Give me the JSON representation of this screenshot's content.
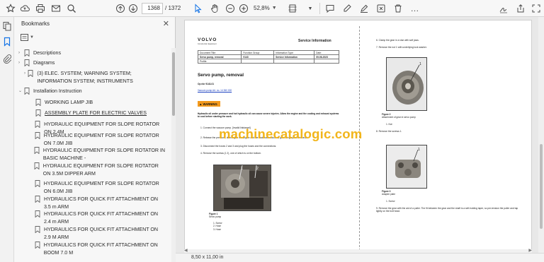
{
  "toolbar": {
    "current_page": "1368",
    "total_pages": "/ 1372",
    "zoom": "52,8%"
  },
  "panel": {
    "title": "Bookmarks",
    "close": "✕"
  },
  "bookmarks": [
    {
      "label": "Descriptions",
      "expand": "›",
      "underline": false
    },
    {
      "label": "Diagrams",
      "expand": "›",
      "underline": false
    },
    {
      "label": "(3) ELEC. SYSTEM; WARNING SYSTEM; INFORMATION SYSTEM; INSTRUMENTS",
      "expand": "›",
      "underline": false
    },
    {
      "label": "Installation Instruction",
      "expand": "⌄",
      "underline": false
    },
    {
      "label": "WORKING LAMP JIB",
      "expand": "",
      "underline": false
    },
    {
      "label": "ASSEMBLY PLATE FOR ELECTRIC VALVES",
      "expand": "",
      "underline": true
    },
    {
      "label": "HYDRAULIC EQUIPMENT FOR SLOPE ROTATOR ON 2.4M",
      "expand": "",
      "underline": false
    },
    {
      "label": "HYDRAULIC EQUIPMENT FOR SLOPE ROTATOR ON 7.0M JIB",
      "expand": "",
      "underline": false
    },
    {
      "label": "HYDRAULIC EQUIPMENT FOR SLOPE ROTATOR IN BASIC MACHINE -",
      "expand": "",
      "underline": false
    },
    {
      "label": "HYDRAULIC EQUIPMENT FOR SLOPE  ROTATOR ON 3.5M DIPPER ARM",
      "expand": "",
      "underline": false
    },
    {
      "label": "HYDRAULIC EQUIPMENT FOR SLOPE  ROTATOR ON 6.0M JIB",
      "expand": "",
      "underline": false
    },
    {
      "label": "HYDRAULICS FOR QUICK FIT ATTACHMENT ON 3.5 m ARM",
      "expand": "",
      "underline": false
    },
    {
      "label": "HYDRAULICS FOR QUICK FIT ATTACHMENT ON 2.4 m ARM",
      "expand": "",
      "underline": false
    },
    {
      "label": "HYDRAULICS FOR QUICK FIT ATTACHMENT ON 2.9 M ARM",
      "expand": "",
      "underline": false
    },
    {
      "label": "HYDRAULICS FOR QUICK FIT ATTACHMENT ON BOOM 7.0 M",
      "expand": "",
      "underline": false
    }
  ],
  "status": {
    "page_size": "8,50 x 11,00 in"
  },
  "document": {
    "brand": "VOLVO",
    "brand_sub": "Construction Equipment",
    "header_title": "Service Information",
    "table": [
      [
        "Document Title:",
        "Function Group:",
        "Information Type:",
        "Date:"
      ],
      [
        "Servo pump, removal",
        "9143",
        "Service Information",
        "09-06-2023"
      ],
      [
        "Profile:",
        "",
        "",
        ""
      ]
    ],
    "title": "Servo pump, removal",
    "op_no": "Op nbr 9143-01",
    "link": "Vacuum pump Art. no. 14 360 000",
    "warning_label": "WARNING",
    "warning_text": "Hydraulic oil under pressure and hot hydraulic oil can cause severe injuries. Allow the engine and the cooling and exhaust systems to cool before starting the work.",
    "steps_left": [
      "1.  Connect the vacuum pump. [Invalid linktarget]",
      "2.  Release the pressure, deenergize the engine and the main valve block as grounding system in travel.",
      "3.  Disconnect the hoses 2 and 3 and plug the hoses and the connections.",
      "4.  Remove the screws (1 2), one of which is on the bottom."
    ],
    "watermark": "machinecatalogic.com",
    "figure1_caption": "Figure 1",
    "figure1_sub": "Servo pump",
    "figure1_items": [
      "1.   Screw",
      "2.   Hose",
      "3.   Hose"
    ],
    "steps_right": [
      "6.  Clamp the gear in a vise with soft jaws.",
      "7.  Remove the nut 1 with underlying lock washer."
    ],
    "figure2_caption": "Figure 2",
    "figure2_sub": "Attachment of gear in servo pump",
    "figure2_items": [
      "1.   Nut"
    ],
    "step8": "8.  Remove the screws 1.",
    "figure3_caption": "Figure 3",
    "figure3_sub": "Adapter plate",
    "figure3_items": [
      "1.   Screw"
    ],
    "step9": "9.  Remove the gear with the aid of a puller. The fit between the gear and the shaft is a self-holding taper, so pre-tension the puller and tap lightly on the bolt head."
  }
}
